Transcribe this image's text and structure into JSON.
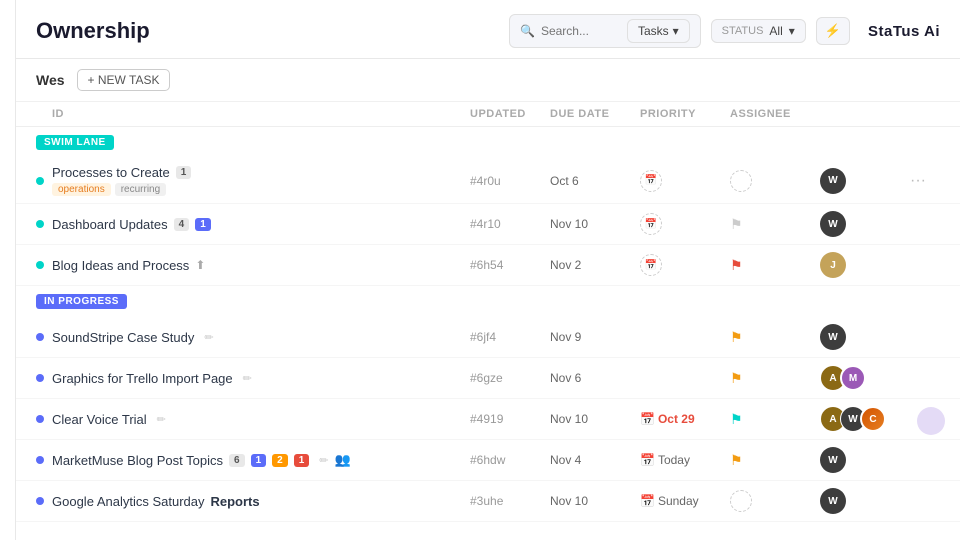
{
  "app": {
    "title": "Ownership",
    "status_ai": "StaTus Ai"
  },
  "header": {
    "search_placeholder": "Search...",
    "tasks_label": "Tasks",
    "status_label": "STATUS",
    "status_value": "All",
    "filter_icon": "▼"
  },
  "user": {
    "name": "Wes",
    "new_task_label": "+ NEW TASK"
  },
  "columns": {
    "id": "ID",
    "updated": "UPDATED",
    "due_date": "DUE DATE",
    "priority": "PRIORITY",
    "assignee": "ASSIGNEE"
  },
  "lanes": [
    {
      "id": "swim-lane",
      "label": "SWIM LANE",
      "type": "swim",
      "tasks": [
        {
          "id": "t1",
          "name": "Processes to Create",
          "badge": "1",
          "tags": [
            "operations",
            "recurring"
          ],
          "task_id": "#4r0u",
          "updated": "Oct 6",
          "due_date": "",
          "due_date_type": "icon-only",
          "priority": "dashed",
          "assignee_count": 1,
          "assignee_type": "single-dark"
        },
        {
          "id": "t2",
          "name": "Dashboard Updates",
          "badge": "4",
          "badge2": "1",
          "badge2_color": "blue",
          "tags": [],
          "task_id": "#4r10",
          "updated": "Nov 10",
          "due_date": "",
          "due_date_type": "icon-only",
          "priority": "flag-gray",
          "assignee_count": 1,
          "assignee_type": "single-dark"
        },
        {
          "id": "t3",
          "name": "Blog Ideas and Process",
          "badge": "",
          "tags": [],
          "task_id": "#6h54",
          "updated": "Nov 2",
          "due_date": "",
          "due_date_type": "icon-only",
          "priority": "flag-red",
          "assignee_count": 1,
          "assignee_type": "single-tan"
        }
      ]
    },
    {
      "id": "in-progress",
      "label": "IN PROGRESS",
      "type": "in-progress",
      "tasks": [
        {
          "id": "t4",
          "name": "SoundStripe Case Study",
          "badge": "",
          "tags": [],
          "task_id": "#6jf4",
          "updated": "Nov 9",
          "due_date": "",
          "due_date_type": "none",
          "priority": "flag-yellow",
          "assignee_count": 1,
          "assignee_type": "single-dark"
        },
        {
          "id": "t5",
          "name": "Graphics for Trello Import Page",
          "badge": "",
          "tags": [],
          "task_id": "#6gze",
          "updated": "Nov 6",
          "due_date": "",
          "due_date_type": "none",
          "priority": "flag-yellow",
          "assignee_count": 2,
          "assignee_type": "multi-two"
        },
        {
          "id": "t6",
          "name": "Clear Voice Trial",
          "badge": "",
          "tags": [],
          "task_id": "#4919",
          "updated": "Nov 10",
          "due_date": "Oct 29",
          "due_date_type": "overdue",
          "priority": "flag-teal",
          "assignee_count": 3,
          "assignee_type": "multi-three"
        },
        {
          "id": "t7",
          "name": "MarketMuse Blog Post Topics",
          "badge": "6",
          "badge2": "1",
          "badge3": "2",
          "badge3_color": "orange",
          "badge4": "1",
          "badge4_color": "blue",
          "tags": [],
          "task_id": "#6hdw",
          "updated": "Nov 4",
          "due_date": "Today",
          "due_date_type": "calendar",
          "priority": "flag-yellow",
          "assignee_count": 1,
          "assignee_type": "single-dark2",
          "has_people": true
        },
        {
          "id": "t8",
          "name": "Google Analytics Saturday Reports",
          "badge": "",
          "tags": [],
          "task_id": "#3uhe",
          "updated": "Nov 10",
          "due_date": "Sunday",
          "due_date_type": "calendar-gray",
          "priority": "dashed",
          "assignee_count": 1,
          "assignee_type": "single-dark"
        }
      ]
    }
  ]
}
